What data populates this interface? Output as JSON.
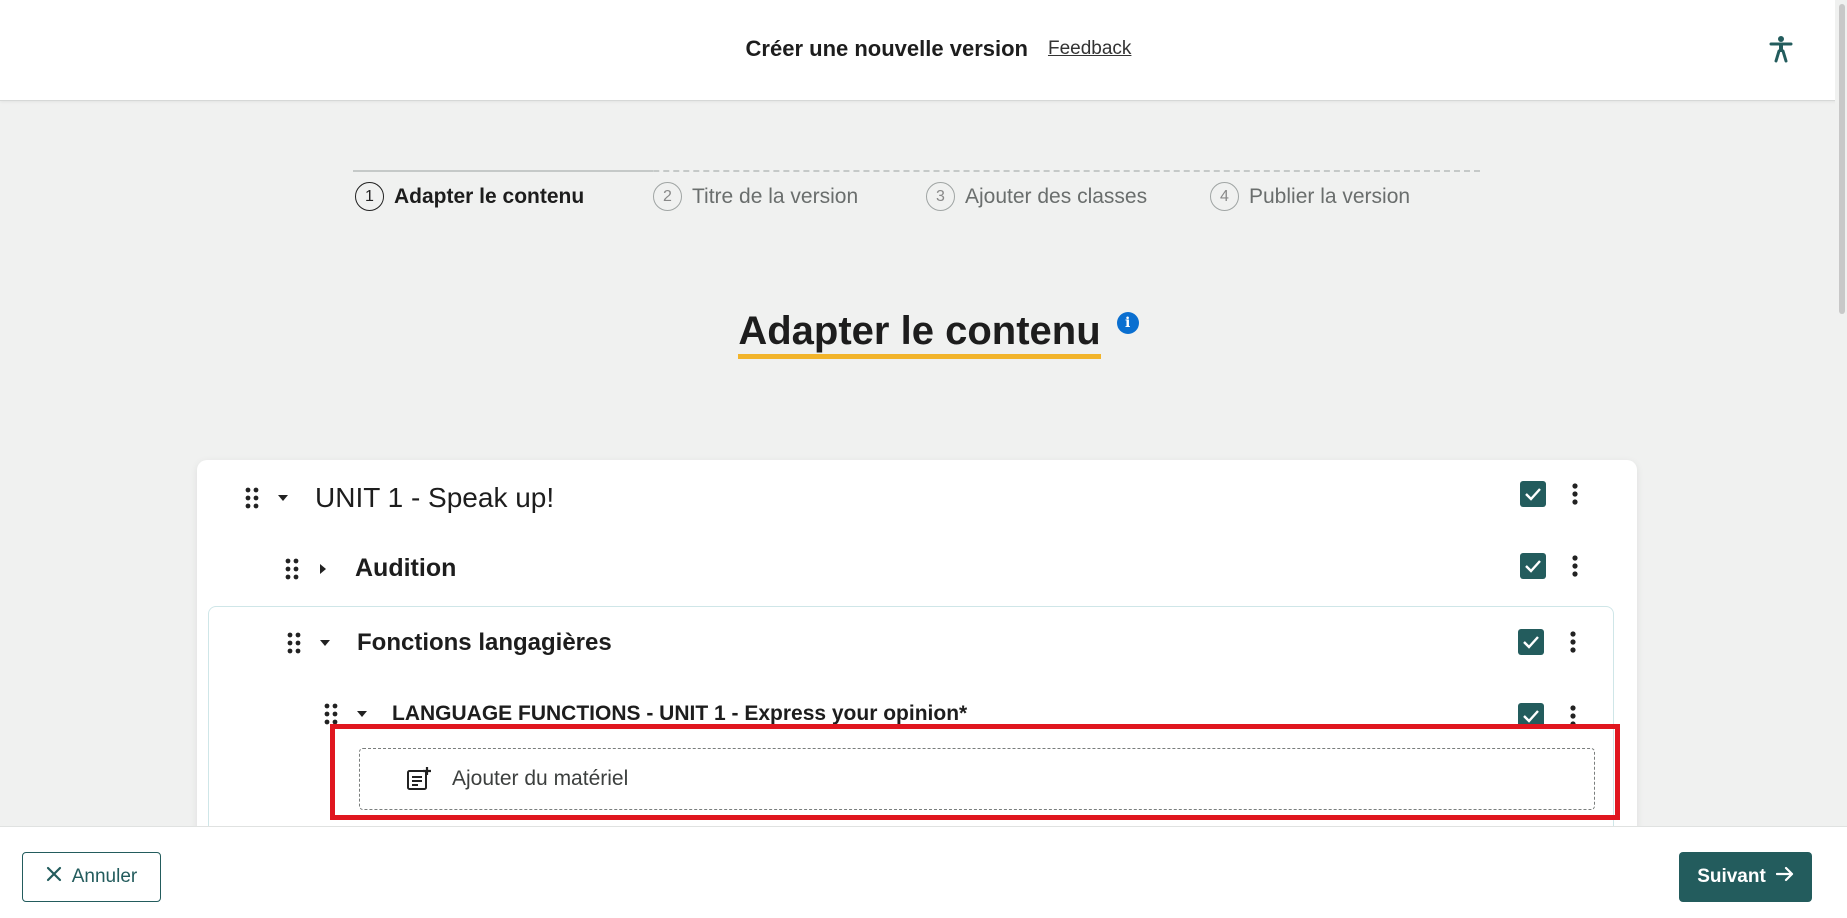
{
  "header": {
    "title": "Créer une nouvelle version",
    "feedback_label": "Feedback",
    "accessibility_icon": "accessibility-icon"
  },
  "stepper": {
    "current_step": 1,
    "steps": [
      {
        "num": "1",
        "label": "Adapter le contenu"
      },
      {
        "num": "2",
        "label": "Titre de la version"
      },
      {
        "num": "3",
        "label": "Ajouter des classes"
      },
      {
        "num": "4",
        "label": "Publier la version"
      }
    ]
  },
  "section": {
    "title": "Adapter le contenu",
    "info_icon": "info-icon"
  },
  "tree": {
    "items": [
      {
        "label": "UNIT 1 - Speak up!",
        "expanded": true,
        "checked": true
      },
      {
        "label": "Audition",
        "expanded": false,
        "checked": true
      },
      {
        "label": "Fonctions langagières",
        "expanded": true,
        "checked": true
      },
      {
        "label": "LANGUAGE FUNCTIONS - UNIT 1 - Express your opinion*",
        "expanded": true,
        "checked": true
      }
    ],
    "add_material_label": "Ajouter du matériel"
  },
  "footer": {
    "cancel_label": "Annuler",
    "next_label": "Suivant"
  },
  "colors": {
    "primary": "#235c5d",
    "accent_underline": "#f2b42b",
    "info": "#0a6fd0",
    "highlight": "#e0161f"
  }
}
